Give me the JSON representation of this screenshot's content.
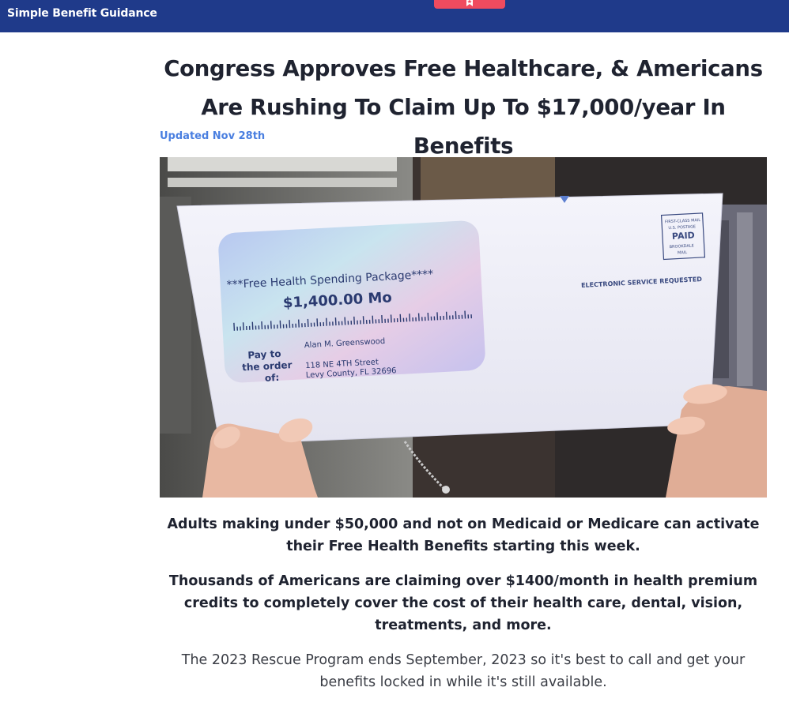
{
  "header": {
    "brand": "Simple Benefit Guidance",
    "accent_color": "#1f3a8a",
    "tab_color": "#ef4b5f",
    "tab_icon": "star-flag-icon"
  },
  "article": {
    "headline": "Congress Approves Free Healthcare, & Americans Are Rushing To Claim Up To $17,000/year In Benefits",
    "updated": "Updated Nov 28th",
    "date_color": "#4a7fe0",
    "hero": {
      "check_title": "***Free Health Spending Package****",
      "check_amount": "$1,400.00 Mo",
      "pay_to_label": "Pay to the order of:",
      "payee_name": "Alan M. Greenswood",
      "payee_address_1": "118 NE 4TH Street",
      "payee_address_2": "Levy County, FL 32696",
      "envelope_notice": "ELECTRONIC SERVICE REQUESTED",
      "postage_line_1": "FIRST-CLASS MAIL",
      "postage_line_2": "U.S. POSTAGE",
      "postage_paid": "PAID",
      "postage_line_3": "BROOKDALE",
      "postage_line_4": "MAIL"
    },
    "paragraphs": [
      "Adults making under $50,000 and not on Medicaid or Medicare can activate their Free Health Benefits starting this week.",
      "Thousands of Americans are claiming over $1400/month in health premium credits to completely cover the cost of their health care, dental, vision, treatments, and more.",
      "The 2023 Rescue Program ends September, 2023 so it's best to call and get your benefits locked in while it's still available."
    ]
  }
}
